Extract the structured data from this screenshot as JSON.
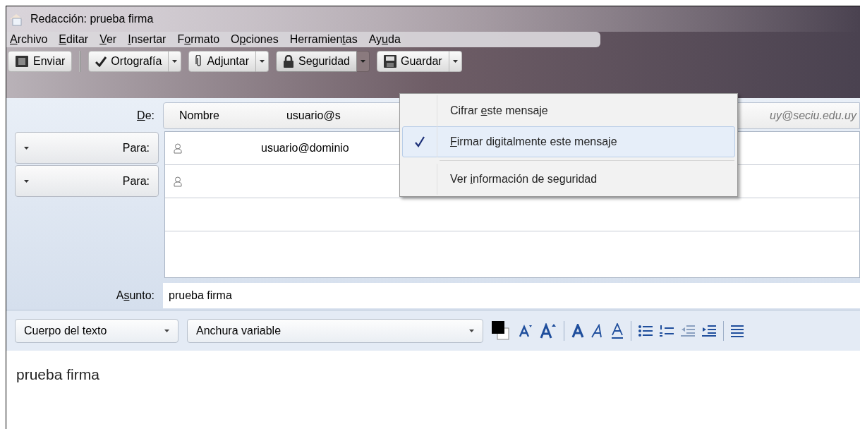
{
  "window": {
    "title": "Redacción: prueba firma"
  },
  "menu_bar": [
    {
      "key": "A",
      "after": "rchivo"
    },
    {
      "key": "E",
      "after": "ditar"
    },
    {
      "key": "V",
      "after": "er"
    },
    {
      "key": "I",
      "after": "nsertar"
    },
    {
      "before": "F",
      "key": "o",
      "after": "rmato"
    },
    {
      "before": "O",
      "key": "p",
      "after": "ciones"
    },
    {
      "before": "Herramien",
      "key": "t",
      "after": "as"
    },
    {
      "before": "Ay",
      "key": "u",
      "after": "da"
    }
  ],
  "toolbar": [
    {
      "kind": "send",
      "label": "Enviar",
      "dropdown": false,
      "pressed": false
    },
    {
      "kind": "spell",
      "label": "Ortografía",
      "dropdown": true,
      "pressed": false
    },
    {
      "kind": "attach",
      "label": "Adjuntar",
      "dropdown": true,
      "pressed": false
    },
    {
      "kind": "security",
      "label": "Seguridad",
      "dropdown": true,
      "pressed": true
    },
    {
      "kind": "save",
      "label": "Guardar",
      "dropdown": true,
      "pressed": false
    }
  ],
  "from": {
    "label_key": "D",
    "label_after": "e:",
    "name": "Nombre",
    "address": "usuario@s",
    "identity": "uy@seciu.edu.uy"
  },
  "recipients": [
    {
      "label": "Para:",
      "address": "usuario@dominio"
    },
    {
      "label": "Para:"
    }
  ],
  "subject": {
    "label_before": "A",
    "label_key": "s",
    "label_after": "unto:",
    "value": "prueba firma"
  },
  "security_menu": [
    {
      "before": "Cifrar ",
      "key": "e",
      "after": "ste mensaje",
      "checked": false,
      "highlighted": false
    },
    {
      "key": "F",
      "after": "irmar digitalmente este mensaje",
      "checked": true,
      "highlighted": true
    },
    {
      "kind": "separator"
    },
    {
      "before": "Ver ",
      "key": "i",
      "after": "nformación de seguridad",
      "checked": false,
      "highlighted": false
    }
  ],
  "format_bar": {
    "paragraph_style": "Cuerpo del texto",
    "font": "Anchura variable"
  },
  "body": "prueba firma"
}
